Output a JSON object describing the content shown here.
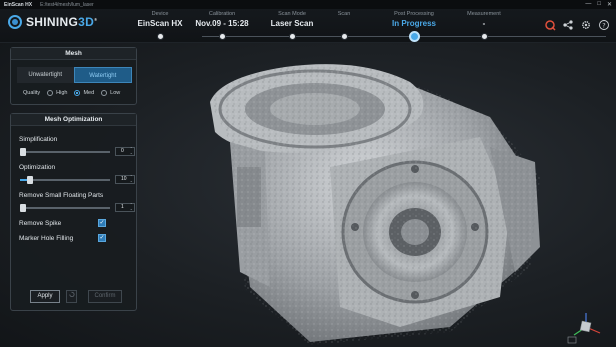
{
  "window": {
    "app_name": "EinScan HX",
    "file_path": "E:/test4/mesh/lum_laser",
    "controls": [
      "—",
      "□",
      "✕"
    ]
  },
  "logo": {
    "text_main": "SHINING",
    "text_accent": "3D",
    "registered": "®"
  },
  "steps": [
    {
      "caption": "Device",
      "value": "EinScan HX"
    },
    {
      "caption": "Calibration",
      "value": "Nov.09 - 15:28"
    },
    {
      "caption": "Scan Mode",
      "value": "Laser Scan"
    },
    {
      "caption": "Scan",
      "value": ""
    },
    {
      "caption": "Post Processing",
      "value": "In Progress"
    },
    {
      "caption": "Measurement",
      "value": "-"
    }
  ],
  "header_icons": [
    "tools-icon",
    "share-icon",
    "settings-icon",
    "help-icon"
  ],
  "mesh": {
    "title": "Mesh",
    "unwatertight": "Unwatertight",
    "watertight": "Watertight",
    "quality_label": "Quality",
    "high": "High",
    "med": "Med",
    "low": "Low",
    "selected_quality": "Med"
  },
  "optimization": {
    "title": "Mesh Optimization",
    "simplification_label": "Simplification",
    "simplification_value": "0",
    "simplification_level": 0,
    "optimization_label": "Optimization",
    "optimization_value": "10",
    "optimization_level": 0.1,
    "floating_label": "Remove Small Floating Parts",
    "floating_value": "1",
    "floating_level": 0,
    "spike_label": "Remove Spike",
    "spike_checked": true,
    "marker_label": "Marker Hole Filling",
    "marker_checked": true,
    "apply": "Apply",
    "undo_icon": "undo-icon",
    "confirm": "Confirm"
  },
  "colors": {
    "accent": "#4aa9e8",
    "brand_red": "#e0503c"
  }
}
